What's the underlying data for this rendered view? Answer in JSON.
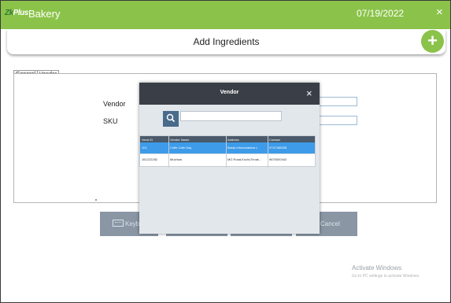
{
  "titlebar": {
    "logo_prefix": "Zk",
    "logo_suffix": "Plus",
    "app_name": "Bakery",
    "date": "07/19/2022",
    "close": "×"
  },
  "header": {
    "title": "Add Ingredients",
    "add_label": "+"
  },
  "tabs": [
    {
      "label": "General",
      "active": false
    },
    {
      "label": "Vendor",
      "active": true
    }
  ],
  "form": {
    "vendor_label": "Vendor",
    "sku_label": "SKU"
  },
  "bottom_buttons": {
    "keyboard_label": "Keybo",
    "cancel_label": "Cancel"
  },
  "modal": {
    "title": "Vendor",
    "close": "×",
    "search_placeholder": "",
    "columns": [
      "Vend ID",
      "Vendor Name",
      "Address",
      "Contact"
    ],
    "rows": [
      {
        "id": "101",
        "name": "Coffe Cafe Day",
        "address": "Basta Infomaratana I...",
        "contact": "9747186028",
        "selected": true
      },
      {
        "id": "161222282",
        "name": "Muchwa",
        "address": "MG Road,Kochi,Ernak...",
        "contact": "9875000442",
        "selected": false
      }
    ]
  },
  "watermark": {
    "title": "Activate Windows",
    "subtitle": "Go to PC settings to activate Windows."
  },
  "colors": {
    "brand": "#8bc34a",
    "modal_header": "#3a3f47",
    "selection": "#3d9be9",
    "button": "#8a96a4"
  }
}
